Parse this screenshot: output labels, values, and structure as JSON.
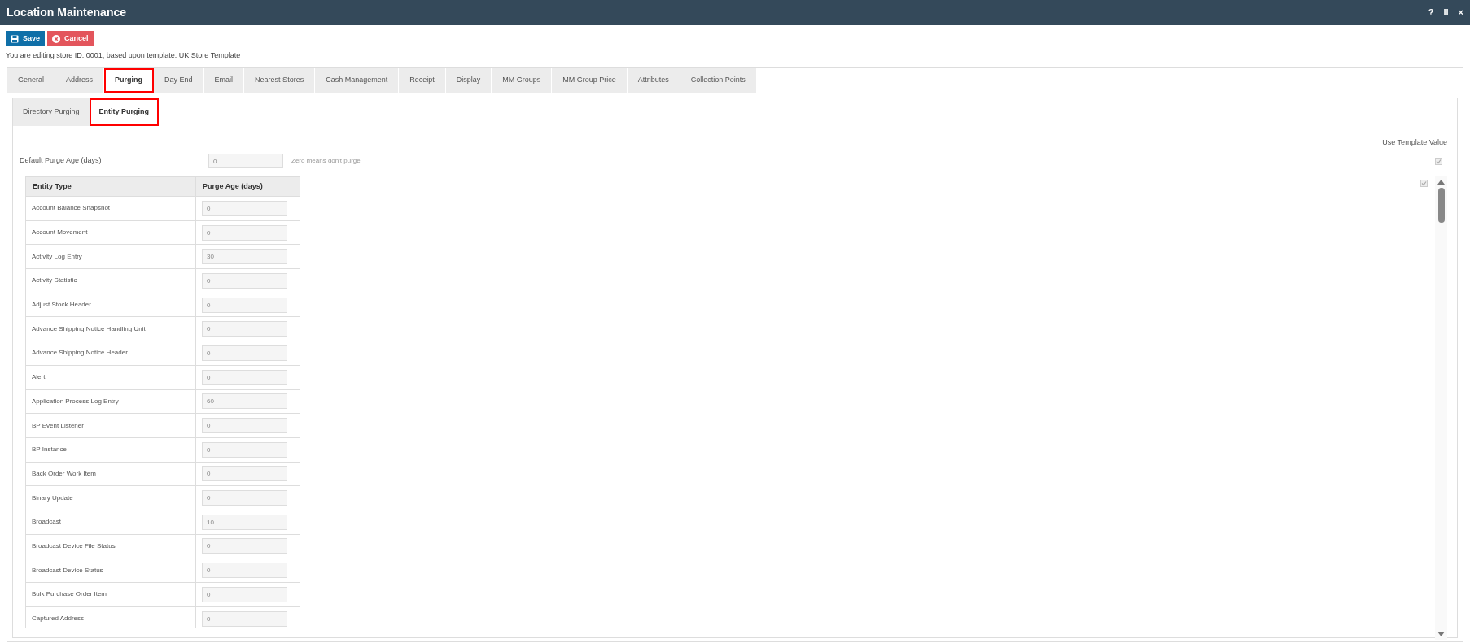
{
  "window": {
    "title": "Location Maintenance",
    "controls": [
      "?",
      "II",
      "×"
    ]
  },
  "toolbar": [
    {
      "kind": "save",
      "label": "Save"
    },
    {
      "kind": "cancel",
      "label": "Cancel"
    }
  ],
  "info": "You are editing store ID: 0001, based upon template: UK Store Template",
  "tabs": [
    {
      "label": "General",
      "selected": false
    },
    {
      "label": "Address",
      "selected": false
    },
    {
      "label": "Purging",
      "selected": true
    },
    {
      "label": "Day End",
      "selected": false
    },
    {
      "label": "Email",
      "selected": false
    },
    {
      "label": "Nearest Stores",
      "selected": false
    },
    {
      "label": "Cash Management",
      "selected": false
    },
    {
      "label": "Receipt",
      "selected": false
    },
    {
      "label": "Display",
      "selected": false
    },
    {
      "label": "MM Groups",
      "selected": false
    },
    {
      "label": "MM Group Price",
      "selected": false
    },
    {
      "label": "Attributes",
      "selected": false
    },
    {
      "label": "Collection Points",
      "selected": false
    }
  ],
  "subtabs": [
    {
      "label": "Directory Purging",
      "selected": false
    },
    {
      "label": "Entity Purging",
      "selected": true
    }
  ],
  "use_template_header": "Use Template Value",
  "default_purge": {
    "label": "Default Purge Age (days)",
    "value": "0",
    "hint": "Zero means don't purge",
    "use_template": {
      "checked": true,
      "disabled": true
    }
  },
  "table": {
    "columns": [
      "Entity Type",
      "Purge Age (days)"
    ],
    "use_template": {
      "checked": true,
      "disabled": true
    },
    "rows": [
      {
        "entity": "Account Balance Snapshot",
        "value": "0"
      },
      {
        "entity": "Account Movement",
        "value": "0"
      },
      {
        "entity": "Activity Log Entry",
        "value": "30"
      },
      {
        "entity": "Activity Statistic",
        "value": "0"
      },
      {
        "entity": "Adjust Stock Header",
        "value": "0"
      },
      {
        "entity": "Advance Shipping Notice Handling Unit",
        "value": "0"
      },
      {
        "entity": "Advance Shipping Notice Header",
        "value": "0"
      },
      {
        "entity": "Alert",
        "value": "0"
      },
      {
        "entity": "Application Process Log Entry",
        "value": "60"
      },
      {
        "entity": "BP Event Listener",
        "value": "0"
      },
      {
        "entity": "BP Instance",
        "value": "0"
      },
      {
        "entity": "Back Order Work Item",
        "value": "0"
      },
      {
        "entity": "Binary Update",
        "value": "0"
      },
      {
        "entity": "Broadcast",
        "value": "10"
      },
      {
        "entity": "Broadcast Device File Status",
        "value": "0"
      },
      {
        "entity": "Broadcast Device Status",
        "value": "0"
      },
      {
        "entity": "Bulk Purchase Order Item",
        "value": "0"
      },
      {
        "entity": "Captured Address",
        "value": "0"
      }
    ]
  }
}
